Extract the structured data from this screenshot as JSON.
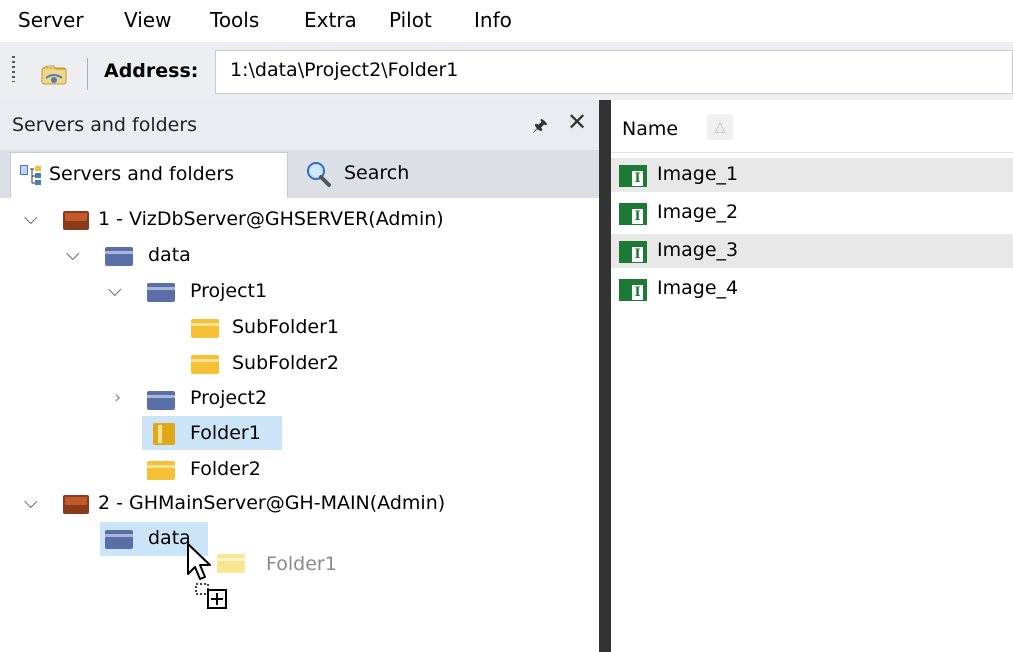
{
  "menu": [
    "Server",
    "View",
    "Tools",
    "Extra",
    "Pilot",
    "Info"
  ],
  "address": {
    "label": "Address:",
    "value": "1:\\data\\Project2\\Folder1"
  },
  "left_panel": {
    "title": "Servers and folders",
    "tabs": [
      {
        "label": "Servers and folders"
      },
      {
        "label": "Search"
      }
    ]
  },
  "tree": {
    "server1": {
      "label": "1 - VizDbServer@GHSERVER(Admin)"
    },
    "data1": {
      "label": "data"
    },
    "project1": {
      "label": "Project1"
    },
    "subfolder1": {
      "label": "SubFolder1"
    },
    "subfolder2": {
      "label": "SubFolder2"
    },
    "project2": {
      "label": "Project2"
    },
    "folder1": {
      "label": "Folder1"
    },
    "folder2": {
      "label": "Folder2"
    },
    "server2": {
      "label": "2 - GHMainServer@GH-MAIN(Admin)"
    },
    "data2": {
      "label": "data"
    },
    "drag_ghost": {
      "label": "Folder1"
    }
  },
  "list": {
    "column_header": "Name",
    "items": [
      {
        "label": "Image_1"
      },
      {
        "label": "Image_2"
      },
      {
        "label": "Image_3"
      },
      {
        "label": "Image_4"
      }
    ],
    "item_icon_letter": "I"
  },
  "colors": {
    "accent_selection": "#cce4f7",
    "folder_blue": "#5a6fa8",
    "folder_yellow": "#f5c033",
    "server_brown": "#8b3a1a",
    "image_green": "#1c7a35"
  }
}
